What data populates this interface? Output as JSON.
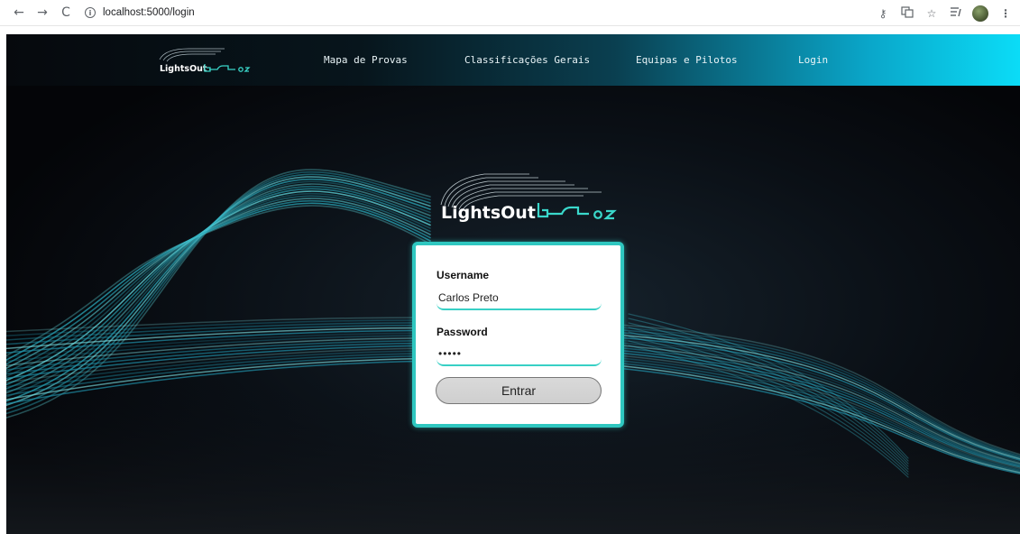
{
  "browser": {
    "url": "localhost:5000/login",
    "nav": {
      "back": "←",
      "forward": "→",
      "reload": "C"
    },
    "icons": [
      "key-icon",
      "translate-icon",
      "star-icon",
      "reading-list-icon",
      "profile-avatar",
      "menu-icon"
    ]
  },
  "site": {
    "logo_text": "LightsOut",
    "nav_items": [
      {
        "label": "Mapa de Provas"
      },
      {
        "label": "Classificações Gerais"
      },
      {
        "label": "Equipas e Pilotos"
      },
      {
        "label": "Login"
      }
    ]
  },
  "login": {
    "logo_text": "LightsOut",
    "username_label": "Username",
    "username_value": "Carlos Preto",
    "password_label": "Password",
    "password_value": "•••••",
    "submit_label": "Entrar"
  },
  "colors": {
    "accent": "#2fc7c0",
    "nav_gradient_end": "#0bdcf7",
    "background": "#05060a"
  }
}
